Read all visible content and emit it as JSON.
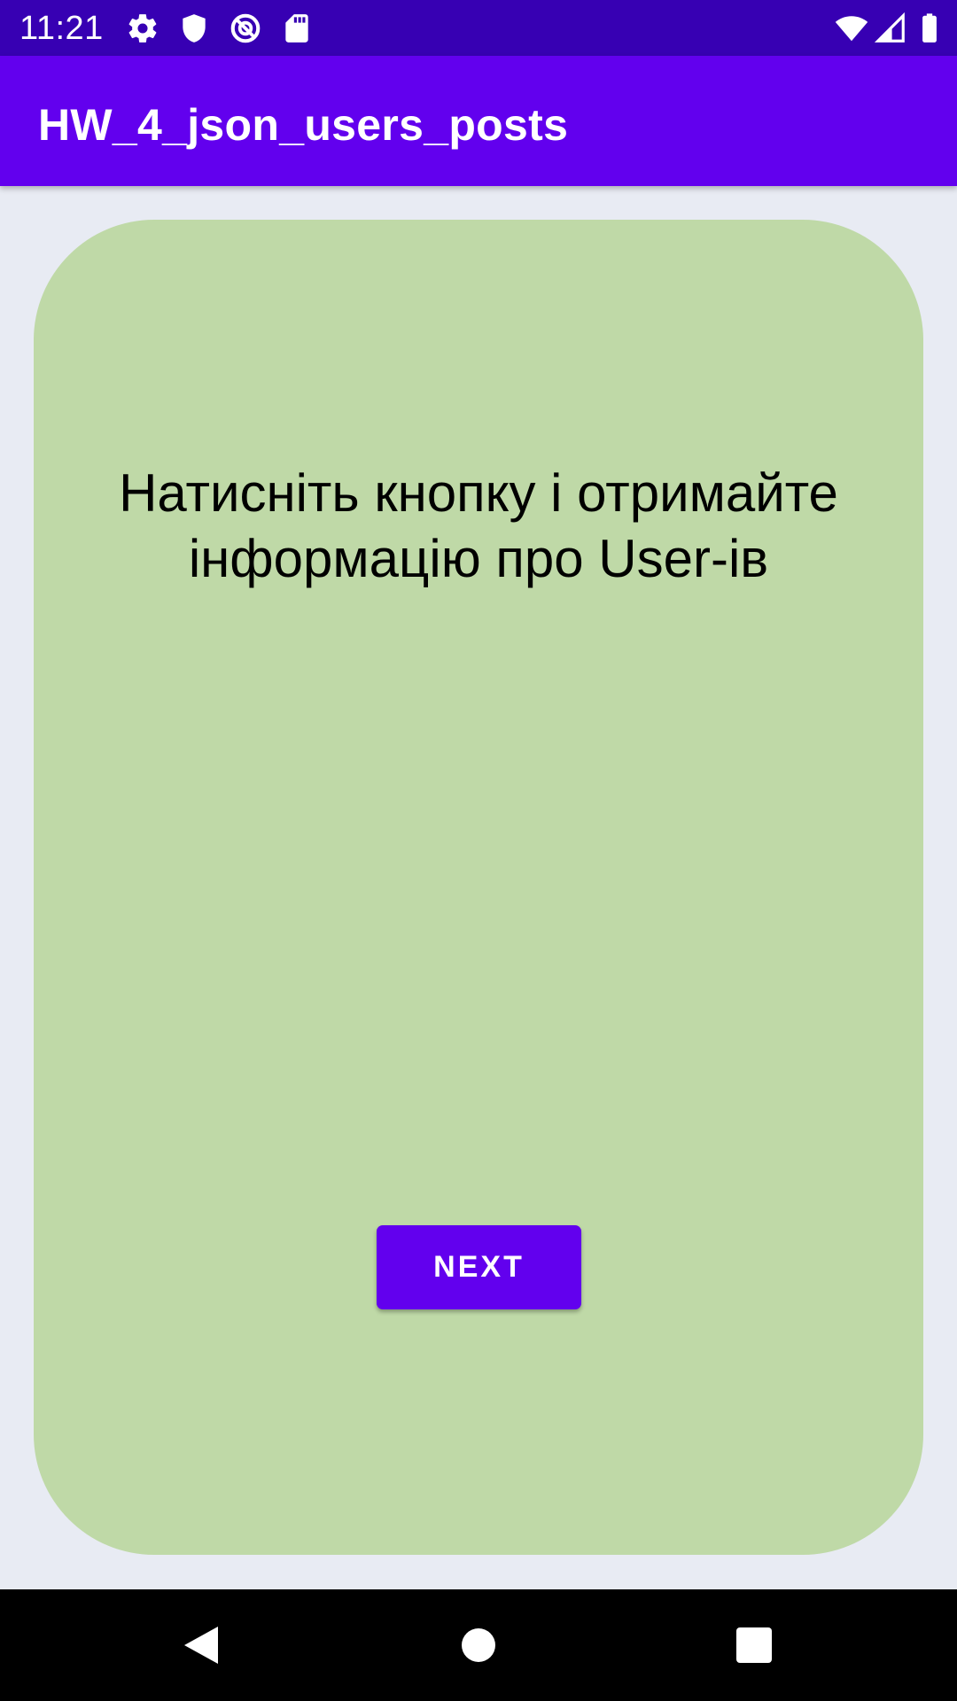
{
  "status_bar": {
    "time": "11:21",
    "left_icons": [
      "gear-icon",
      "shield-icon",
      "data-saver-icon",
      "sd-card-icon"
    ],
    "right_icons": [
      "wifi-icon",
      "cell-signal-icon",
      "battery-icon"
    ]
  },
  "app_bar": {
    "title": "HW_4_json_users_posts"
  },
  "card": {
    "prompt_text": "Натисніть кнопку і отримайте інформацію про User-ів",
    "next_label": "NEXT"
  },
  "nav_bar": {
    "buttons": [
      "back-icon",
      "home-icon",
      "recents-icon"
    ]
  },
  "colors": {
    "status_bar": "#3700b3",
    "app_bar": "#6200ee",
    "background": "#e8ebf3",
    "card": "#bfd9a7",
    "button": "#6200ee"
  }
}
